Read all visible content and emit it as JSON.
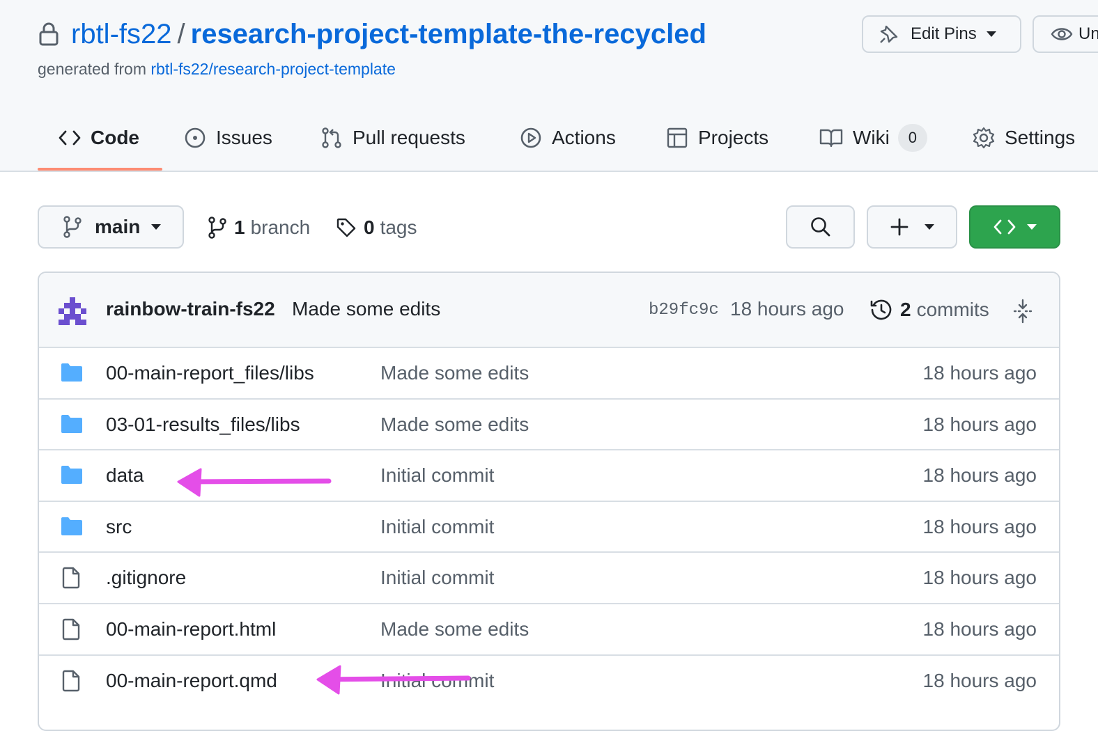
{
  "repo": {
    "owner": "rbtl-fs22",
    "separator": "/",
    "name": "research-project-template-the-recycled",
    "generated_prefix": "generated from",
    "generated_source": "rbtl-fs22/research-project-template"
  },
  "header_buttons": {
    "edit_pins": "Edit Pins",
    "watch": "Un"
  },
  "tabs": [
    {
      "label": "Code"
    },
    {
      "label": "Issues"
    },
    {
      "label": "Pull requests"
    },
    {
      "label": "Actions"
    },
    {
      "label": "Projects"
    },
    {
      "label": "Wiki",
      "count": "0"
    },
    {
      "label": "Settings"
    }
  ],
  "toolbar": {
    "branch": "main",
    "branch_count": "1",
    "branch_word": "branch",
    "tag_count": "0",
    "tag_word": "tags"
  },
  "latest_commit": {
    "author": "rainbow-train-fs22",
    "message": "Made some edits",
    "sha": "b29fc9c",
    "time": "18 hours ago",
    "commit_count": "2",
    "commit_word": "commits"
  },
  "files": [
    {
      "name": "00-main-report_files/libs",
      "type": "folder",
      "message": "Made some edits",
      "time": "18 hours ago"
    },
    {
      "name": "03-01-results_files/libs",
      "type": "folder",
      "message": "Made some edits",
      "time": "18 hours ago"
    },
    {
      "name": "data",
      "type": "folder",
      "message": "Initial commit",
      "time": "18 hours ago"
    },
    {
      "name": "src",
      "type": "folder",
      "message": "Initial commit",
      "time": "18 hours ago"
    },
    {
      "name": ".gitignore",
      "type": "file",
      "message": "Initial commit",
      "time": "18 hours ago"
    },
    {
      "name": "00-main-report.html",
      "type": "file",
      "message": "Made some edits",
      "time": "18 hours ago"
    },
    {
      "name": "00-main-report.qmd",
      "type": "file",
      "message": "Initial commit",
      "time": "18 hours ago"
    }
  ],
  "colors": {
    "link": "#0969da",
    "folder": "#54aeff",
    "code_button": "#2da44e",
    "annotation_arrow": "#e44ee8",
    "active_tab_underline": "#fd8c73"
  }
}
